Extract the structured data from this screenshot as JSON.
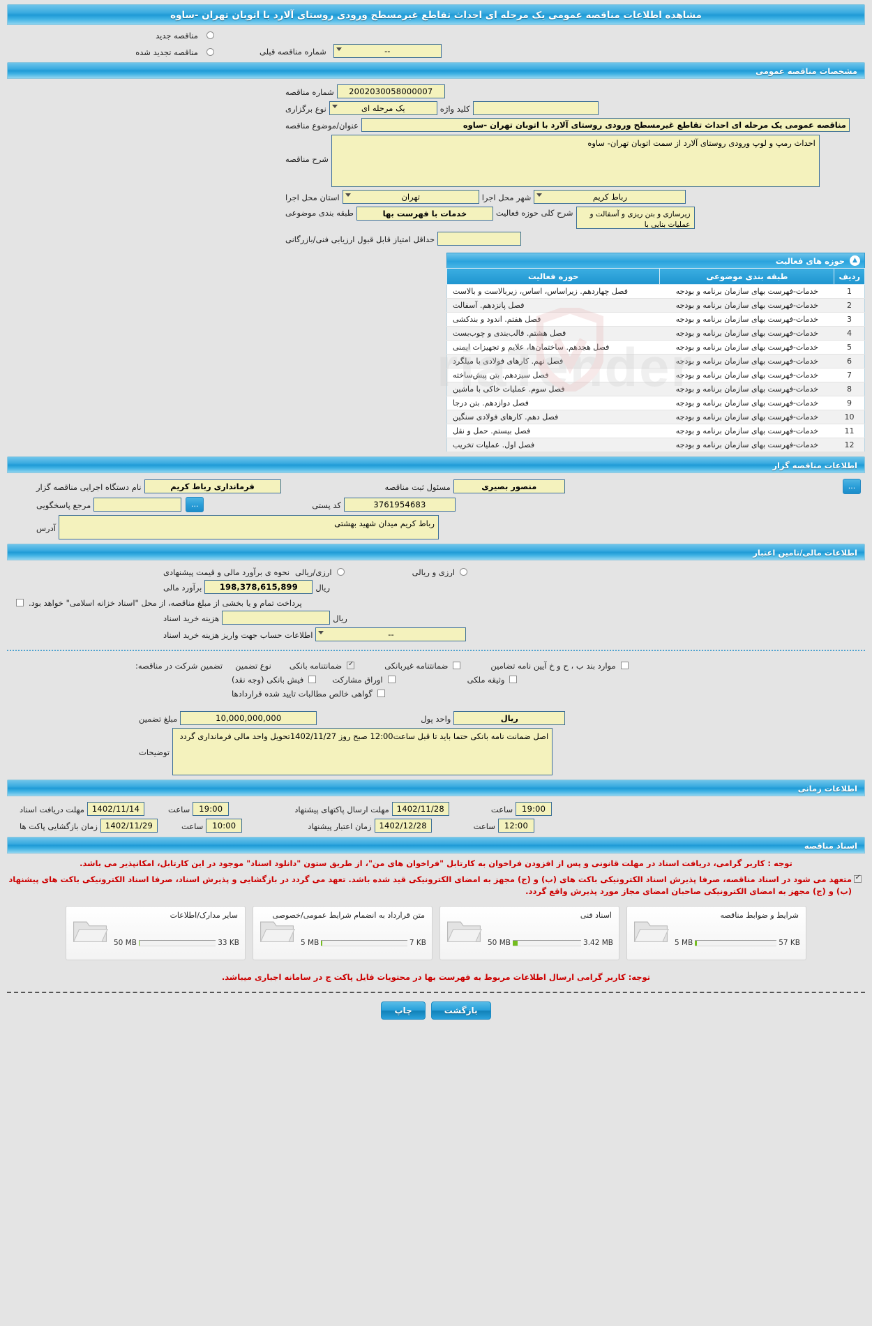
{
  "page_title": "مشاهده اطلاعات مناقصه عمومی یک مرحله ای احداث تقاطع غیرمسطح ورودی روستای آلارد با اتوبان تهران -ساوه",
  "top": {
    "new_tender_label": "مناقصه جدید",
    "renewed_tender_label": "مناقصه تجدید شده",
    "prev_tender_number_label": "شماره مناقصه قبلی",
    "prev_tender_number_value": "--"
  },
  "general": {
    "section_title": "مشخصات مناقصه عمومی",
    "tender_number_label": "شماره مناقصه",
    "tender_number_value": "2002030058000007",
    "holding_type_label": "نوع برگزاری",
    "holding_type_value": "یک مرحله ای",
    "keyword_label": "کلید واژه",
    "keyword_value": "",
    "subject_label": "عنوان/موضوع مناقصه",
    "subject_value": "مناقصه عمومی یک مرحله ای احداث تقاطع غیرمسطح ورودی روستای  آلارد با اتوبان تهران -ساوه",
    "description_label": "شرح مناقصه",
    "description_value": "احداث رمپ و لوپ ورودی روستای آلارد از سمت اتوبان تهران- ساوه",
    "province_label": "استان محل اجرا",
    "province_value": "تهران",
    "city_label": "شهر محل اجرا",
    "city_value": "رباط کریم",
    "classification_label": "طبقه بندی موضوعی",
    "classification_value": "خدمات با فهرست بها",
    "activity_desc_label": "شرح کلی حوزه فعالیت",
    "activity_desc_value": "زیرسازی و  بتن ریزی و آسفالت  و عملیات بنایی با",
    "min_score_label": "حداقل امتیاز قابل قبول ارزیابی فنی/بازرگانی",
    "min_score_value": ""
  },
  "activity_table": {
    "title": "حوزه های فعالیت",
    "columns": [
      "ردیف",
      "طبقه بندی موضوعی",
      "حوزه فعالیت"
    ],
    "rows": [
      {
        "idx": "1",
        "classification": "خدمات-فهرست بهای سازمان برنامه و بودجه",
        "area": "فصل چهاردهم. زیراساس، اساس، زیربالاست  و بالاست"
      },
      {
        "idx": "2",
        "classification": "خدمات-فهرست بهای سازمان برنامه و بودجه",
        "area": "فصل پانزدهم. آسفالت"
      },
      {
        "idx": "3",
        "classification": "خدمات-فهرست بهای سازمان برنامه و بودجه",
        "area": "فصل هفتم. اندود و بندکشی"
      },
      {
        "idx": "4",
        "classification": "خدمات-فهرست بهای سازمان برنامه و بودجه",
        "area": "فصل هشتم. قالب‌بندی و چوب‌بست"
      },
      {
        "idx": "5",
        "classification": "خدمات-فهرست بهای سازمان برنامه و بودجه",
        "area": "فصل هجدهم. ساختمان‌ها، علایم و تجهیزات ایمنی"
      },
      {
        "idx": "6",
        "classification": "خدمات-فهرست بهای سازمان برنامه و بودجه",
        "area": "فصل نهم. کارهای فولادی با میلگرد"
      },
      {
        "idx": "7",
        "classification": "خدمات-فهرست بهای سازمان برنامه و بودجه",
        "area": "فصل سیزدهم. بتن پیش‌ساخته"
      },
      {
        "idx": "8",
        "classification": "خدمات-فهرست بهای سازمان برنامه و بودجه",
        "area": "فصل سوم. عملیات خاکی با ماشین"
      },
      {
        "idx": "9",
        "classification": "خدمات-فهرست بهای سازمان برنامه و بودجه",
        "area": "فصل دوازدهم. بتن درجا"
      },
      {
        "idx": "10",
        "classification": "خدمات-فهرست بهای سازمان برنامه و بودجه",
        "area": "فصل دهم. کارهای فولادی سنگین"
      },
      {
        "idx": "11",
        "classification": "خدمات-فهرست بهای سازمان برنامه و بودجه",
        "area": "فصل بیستم. حمل و نقل"
      },
      {
        "idx": "12",
        "classification": "خدمات-فهرست بهای سازمان برنامه و بودجه",
        "area": "فصل اول. عملیات تخریب"
      }
    ]
  },
  "authority": {
    "section_title": "اطلاعات مناقصه گزار",
    "agency_label": "نام دستگاه اجرایی مناقصه گزار",
    "agency_value": "فرمانداری رباط کریم",
    "registrar_label": "مسئول ثبت مناقصه",
    "registrar_value": "منصور بصیری",
    "reference_label": "مرجع پاسخگویی",
    "reference_value": "",
    "postal_code_label": "کد پستی",
    "postal_code_value": "3761954683",
    "address_label": "آدرس",
    "address_value": "رباط کریم میدان شهید بهشتی",
    "ellipsis_label": "..."
  },
  "finance": {
    "section_title": "اطلاعات مالی/تامین اعتبار",
    "estimate_method_label": "نحوه ی برآورد مالی و قیمت پیشنهادی",
    "option_rial": "ارزی/ریالی",
    "option_rial_and_currency": "ارزی و ریالی",
    "estimate_label": "برآورد مالی",
    "estimate_value": "198,378,615,899",
    "currency_unit": "ریال",
    "islamic_treasury_note": "پرداخت تمام و یا بخشی از مبلغ مناقصه، از محل \"اسناد خزانه اسلامی\" خواهد بود.",
    "doc_cost_label": "هزینه خرید اسناد",
    "doc_cost_value": "",
    "doc_cost_unit": "ریال",
    "account_info_label": "اطلاعات حساب جهت واریز هزینه خرید اسناد",
    "account_info_value": "--"
  },
  "guarantee": {
    "participation_label": "تضمین شرکت در مناقصه:",
    "type_label": "نوع تضمین",
    "options": [
      {
        "label": "ضمانتنامه بانکی",
        "checked": true
      },
      {
        "label": "ضمانتنامه غیربانکی",
        "checked": false
      },
      {
        "label": "موارد بند ب ، ح و خ آیین نامه تضامین",
        "checked": false
      },
      {
        "label": "فیش بانکی (وجه نقد)",
        "checked": false
      },
      {
        "label": "اوراق مشارکت",
        "checked": false
      },
      {
        "label": "وثیقه ملکی",
        "checked": false
      },
      {
        "label": "گواهی خالص مطالبات تایید شده قراردادها",
        "checked": false
      }
    ],
    "amount_label": "مبلغ تضمین",
    "amount_value": "10,000,000,000",
    "currency_label": "واحد پول",
    "currency_value": "ریال",
    "notes_label": "توضیحات",
    "notes_value": "اصل ضمانت نامه بانکی حتما باید تا قبل ساعت12:00 صبح روز 1402/11/27تحویل واحد مالی فرمانداری گردد"
  },
  "timing": {
    "section_title": "اطلاعات زمانی",
    "doc_receive_label": "مهلت دریافت اسناد",
    "doc_receive_date": "1402/11/14",
    "doc_receive_hour_label": "ساعت",
    "doc_receive_hour": "19:00",
    "submit_label": "مهلت ارسال پاکتهای پیشنهاد",
    "submit_date": "1402/11/28",
    "submit_hour_label": "ساعت",
    "submit_hour": "19:00",
    "opening_label": "زمان بازگشایی پاکت ها",
    "opening_date": "1402/11/29",
    "opening_hour_label": "ساعت",
    "opening_hour": "10:00",
    "validity_label": "زمان اعتبار پیشنهاد",
    "validity_date": "1402/12/28",
    "validity_hour_label": "ساعت",
    "validity_hour": "12:00"
  },
  "documents": {
    "section_title": "اسناد مناقصه",
    "notice_1": "توجه : کاربر گرامی، دریافت اسناد در مهلت قانونی و پس از افزودن فراخوان به کارتابل \"فراخوان های من\"، از طریق ستون \"دانلود اسناد\" موجود در این کارتابل، امکانپذیر می باشد.",
    "notice_2": "متعهد می شود در اسناد مناقصه، صرفا پذیرش اسناد الکترونیکی باکت های (ب) و (ج) مجهز به امضای الکترونیکی قید شده باشد. تعهد می گردد در بازگشایی و پذیرش اسناد، صرفا اسناد الکترونیکی باکت های پیشنهاد (ب) و (ج) مجهز به امضای الکترونیکی صاحبان امضای مجاز مورد پذیرش واقع گردد.",
    "notice_checked": true,
    "cards": [
      {
        "label": "شرایط و ضوابط مناقصه",
        "size": "57 KB",
        "max": "5 MB",
        "fill_pct": 2
      },
      {
        "label": "اسناد فنی",
        "size": "3.42 MB",
        "max": "50 MB",
        "fill_pct": 7
      },
      {
        "label": "متن قرارداد به انضمام شرایط عمومی/خصوصی",
        "size": "7 KB",
        "max": "5 MB",
        "fill_pct": 1
      },
      {
        "label": "سایر مدارک/اطلاعات",
        "size": "33 KB",
        "max": "50 MB",
        "fill_pct": 1
      }
    ],
    "footer_notice": "توجه: کاربر گرامی ارسال اطلاعات مربوط به فهرست بها در محتویات فایل پاکت ج در سامانه اجباری میباشد."
  },
  "footer": {
    "print_label": "چاپ",
    "back_label": "بازگشت"
  },
  "watermark": {
    "text": "riaTender"
  }
}
